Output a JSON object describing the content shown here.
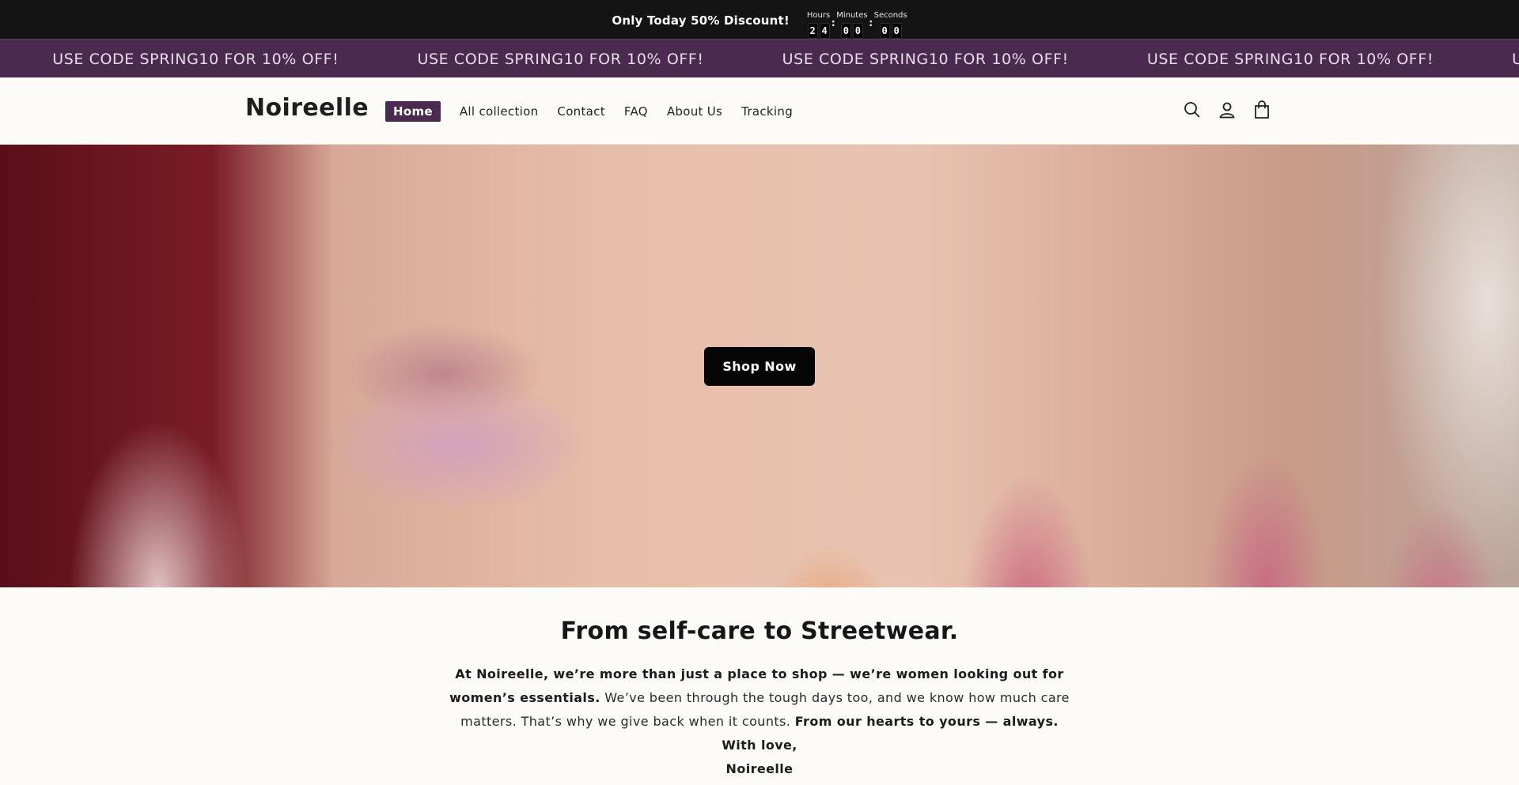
{
  "topbar": {
    "text": "Only Today 50% Discount!",
    "labels": {
      "hours": "Hours",
      "minutes": "Minutes",
      "seconds": "Seconds"
    },
    "digits": {
      "h1": "2",
      "h2": "4",
      "m1": "0",
      "m2": "0",
      "s1": "0",
      "s2": "0"
    },
    "colon": ":"
  },
  "marquee": {
    "text": "USE CODE SPRING10 FOR 10% OFF!",
    "first_partial": "10% OFF!"
  },
  "header": {
    "logo": "Noireelle",
    "nav": [
      "Home",
      "All collection",
      "Contact",
      "FAQ",
      "About Us",
      "Tracking"
    ],
    "icons": [
      "search-icon",
      "account-icon",
      "cart-icon"
    ]
  },
  "hero": {
    "button": "Shop Now"
  },
  "about": {
    "title": "From self-care to Streetwear.",
    "bold_intro": "At Noireelle, we’re more than just a place to shop — we’re women looking out for women’s essentials.",
    "body": " We’ve been through the tough days too, and we know how much care matters. That’s why we give back when it counts. ",
    "bold_outro": "From our hearts to yours — always.",
    "sign_line1": "With love,",
    "sign_line2": "Noireelle"
  },
  "colors": {
    "topbar_bg": "#141414",
    "marquee_bg": "#4a2a4f",
    "accent": "#4a2a4f",
    "page_bg": "#fcfbf8"
  }
}
